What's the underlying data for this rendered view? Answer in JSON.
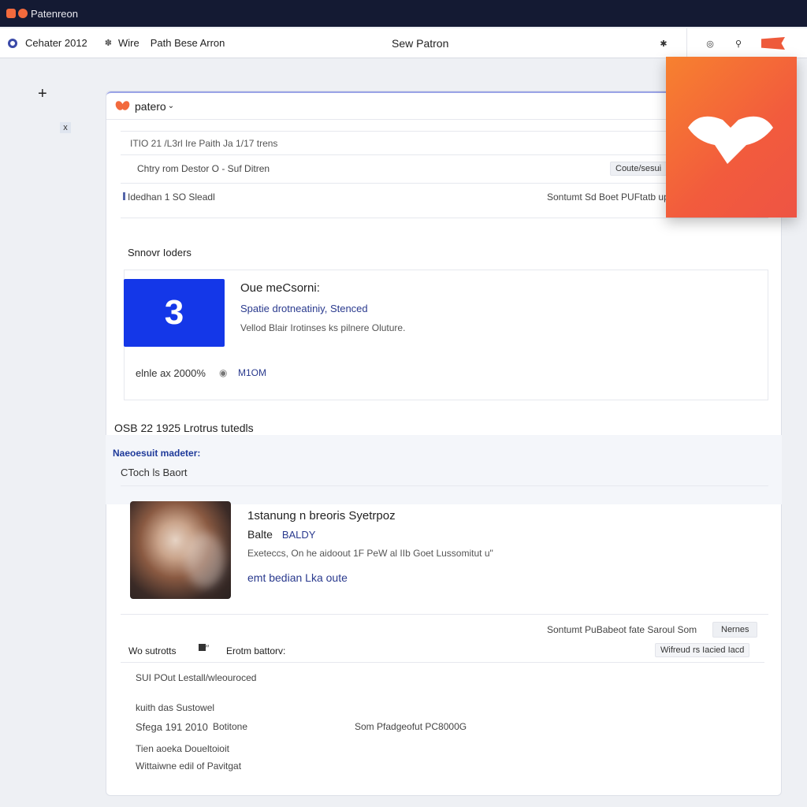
{
  "titlebar": {
    "title": "Patenreon"
  },
  "toolbar": {
    "item1": "Cehater 2012",
    "item2_icon": "paw-icon",
    "item2": "Wire",
    "item3": "Path Bese Arron",
    "center_title": "Sew Patron"
  },
  "rail": {
    "plus": "+",
    "x": "x"
  },
  "panel": {
    "brand": "patero",
    "row1": "ITIO 21 /L3rl Ire Paith Ja 1/17 trens",
    "row2": "Chtry rom Destor O - Suf Ditren",
    "row2_button": "Coute/sesui",
    "row3_left": "Idedhan 1 SO Sleadl",
    "row3_right": "Sontumt Sd Boet PUFtatb up",
    "section_label": "Snnovr Ioders"
  },
  "feature": {
    "tile_number": "3",
    "title": "Oue meCsorni:",
    "subtitle": "Spatie drotneatiniy, Stenced",
    "description": "Vellod Blair Irotinses ks pilnere Oluture.",
    "meta_left": "elnle ax 2000%",
    "meta_right": "M1OM"
  },
  "section2": {
    "heading": "OSB 22 1925 Lrotrus tutedls",
    "subheading": "Naeoesuit madeter:",
    "caption": "CToch ls Baort"
  },
  "post": {
    "title": "1stanung n breoris Syetrpoz",
    "badge_prefix": "Balte",
    "badge": "BALDY",
    "excerpt": "Exeteccs, On he aidoout 1F PeW al IIb Goet Lussomitut u\"",
    "link": "emt bedian Lka oute"
  },
  "footer": {
    "right_text": "Sontumt PuBabeot fate Saroul Som",
    "right_button": "Nernes",
    "left_label": "Wo sutrotts",
    "bottom_label": "Erotm battorv:",
    "right_link": "Wifreud rs Iacied Iacd",
    "line1": "SUI POut Lestall/wleouroced",
    "line2": "kuith das Sustowel",
    "line3a": "Sfega 191 2010",
    "line3b": "Botitone",
    "line3c": "Som Pfadgeofut PC8000G",
    "line4": "Tien aoeka Doueltoioit",
    "line5": "Wittaiwne edil of Pavitgat"
  },
  "colors": {
    "titlebar": "#141a33",
    "accent_orange": "#f26a3d",
    "tile_blue": "#1437e8",
    "link_blue": "#2a3a8e"
  }
}
